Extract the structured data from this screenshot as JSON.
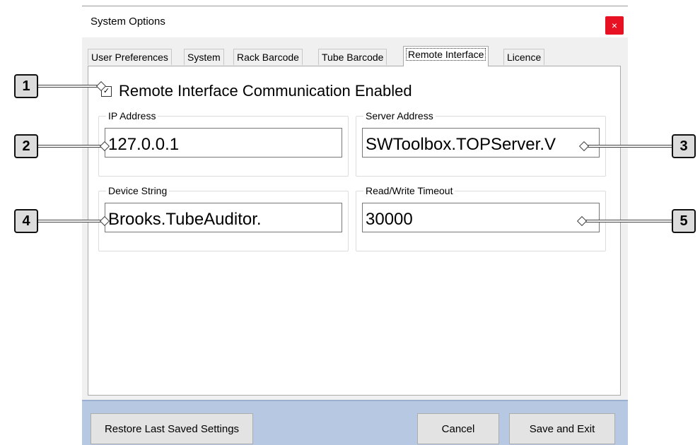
{
  "window": {
    "title": "System Options",
    "close_glyph": "×"
  },
  "tabs": [
    {
      "label": "User Preferences"
    },
    {
      "label": "System"
    },
    {
      "label": "Rack Barcode"
    },
    {
      "label": "Tube Barcode"
    },
    {
      "label": "Remote Interface",
      "active": true
    },
    {
      "label": "Licence"
    }
  ],
  "remote": {
    "checkbox_glyph": "✓",
    "comm_enabled_label": "Remote Interface Communication Enabled",
    "ip_group_label": "IP Address",
    "ip_value": "127.0.0.1",
    "server_group_label": "Server Address",
    "server_value": "SWToolbox.TOPServer.V",
    "device_group_label": "Device String",
    "device_value": "Brooks.TubeAuditor.",
    "timeout_group_label": "Read/Write Timeout",
    "timeout_value": "30000"
  },
  "buttons": {
    "restore": "Restore Last Saved Settings",
    "cancel": "Cancel",
    "save_exit": "Save and Exit"
  },
  "callouts": [
    "1",
    "2",
    "3",
    "4",
    "5"
  ],
  "colors": {
    "close": "#e81123",
    "footer": "#b6c8e2"
  }
}
